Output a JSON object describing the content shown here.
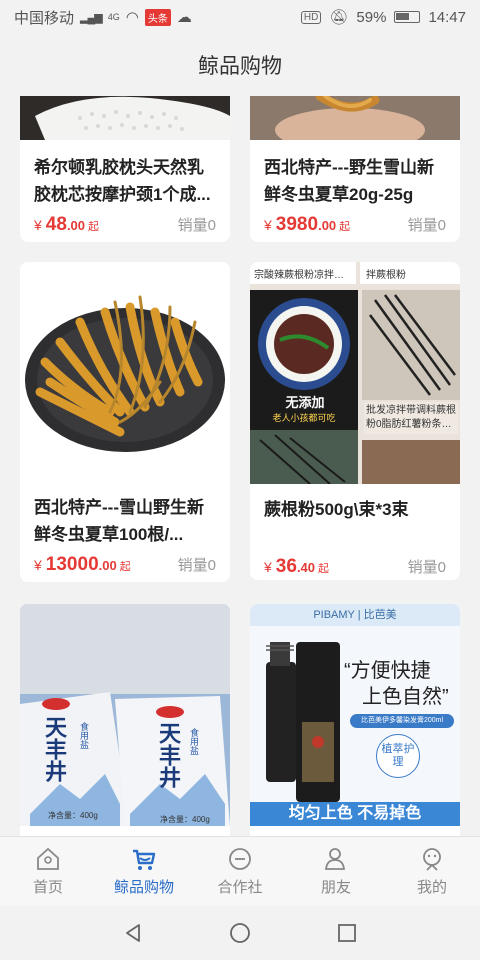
{
  "status_bar": {
    "carrier": "中国移动",
    "network": "4G",
    "app_badge": "头条",
    "hd": "HD",
    "battery": "59%",
    "time": "14:47"
  },
  "header": {
    "title": "鲸品购物"
  },
  "products": [
    {
      "title": "希尔顿乳胶枕头天然乳胶枕芯按摩护颈1个成...",
      "currency": "¥",
      "price_int": "48",
      "price_dec": ".00",
      "suffix": "起",
      "sales": "销量0"
    },
    {
      "title": "西北特产---野生雪山新鲜冬虫夏草20g-25g",
      "currency": "¥",
      "price_int": "3980",
      "price_dec": ".00",
      "suffix": "起",
      "sales": "销量0"
    },
    {
      "title": "西北特产---雪山野生新鲜冬虫夏草100根/...",
      "currency": "¥",
      "price_int": "13000",
      "price_dec": ".00",
      "suffix": "起",
      "sales": "销量0"
    },
    {
      "title": "蕨根粉500g\\束*3束",
      "currency": "¥",
      "price_int": "36",
      "price_dec": ".40",
      "suffix": "起",
      "sales": "销量0"
    }
  ],
  "image_texts": {
    "fern_top_left": "宗酸辣蕨根粉凉拌…",
    "fern_top_right": "拌蕨根粉",
    "fern_stamp": "无添加",
    "fern_stamp_sub": "老人小孩都可吃",
    "fern_desc": "批发凉拌带调料蕨根粉0脂肪红薯粉条…",
    "salt_brand_1": "天丰井",
    "salt_sub": "食用盐",
    "salt_net": "净含量：400g",
    "pibamy_brand": "PIBAMY | 比芭美",
    "pibamy_slogan_1": "“方便快捷",
    "pibamy_slogan_2": "上色自然”",
    "pibamy_small": "比芭美伊多馨染发膏200ml",
    "pibamy_badge": "植萃护理",
    "pibamy_bottom": "均匀上色 不易掉色"
  },
  "tabs": [
    {
      "label": "首页",
      "icon": "home-icon"
    },
    {
      "label": "鲸品购物",
      "icon": "cart-icon",
      "active": true
    },
    {
      "label": "合作社",
      "icon": "coop-icon"
    },
    {
      "label": "朋友",
      "icon": "friends-icon"
    },
    {
      "label": "我的",
      "icon": "profile-icon"
    }
  ],
  "colors": {
    "accent": "#2a6ec7",
    "price": "#e53935"
  }
}
